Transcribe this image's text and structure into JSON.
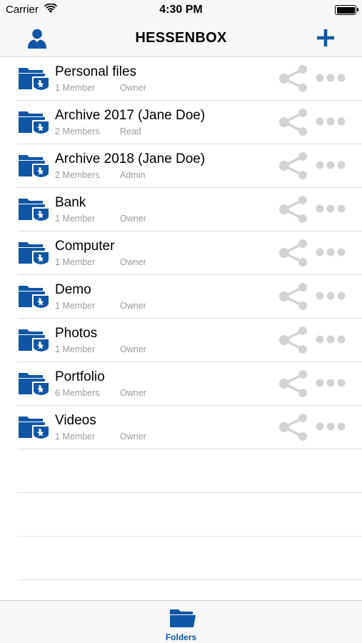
{
  "status_bar": {
    "carrier": "Carrier",
    "time": "4:30 PM",
    "wifi_icon": "wifi-icon",
    "battery_icon": "battery-icon"
  },
  "nav": {
    "title": "HESSENBOX",
    "left_icon": "person-icon",
    "right_icon": "plus-icon"
  },
  "colors": {
    "brand_blue": "#0e56a5",
    "share_gray": "#d3d3d3",
    "meta_gray": "#9a9a9a"
  },
  "folders": [
    {
      "name": "Personal files",
      "members": "1 Member",
      "role": "Owner"
    },
    {
      "name": "Archive 2017 (Jane Doe)",
      "members": "2 Members",
      "role": "Read"
    },
    {
      "name": "Archive 2018 (Jane Doe)",
      "members": "2 Members",
      "role": "Admin"
    },
    {
      "name": "Bank",
      "members": "1 Member",
      "role": "Owner"
    },
    {
      "name": "Computer",
      "members": "1 Member",
      "role": "Owner"
    },
    {
      "name": "Demo",
      "members": "1 Member",
      "role": "Owner"
    },
    {
      "name": "Photos",
      "members": "1 Member",
      "role": "Owner"
    },
    {
      "name": "Portfolio",
      "members": "6 Members",
      "role": "Owner"
    },
    {
      "name": "Videos",
      "members": "1 Member",
      "role": "Owner"
    }
  ],
  "tab_bar": {
    "tabs": [
      {
        "label": "Folders",
        "icon": "folder-icon",
        "selected": true
      }
    ]
  }
}
